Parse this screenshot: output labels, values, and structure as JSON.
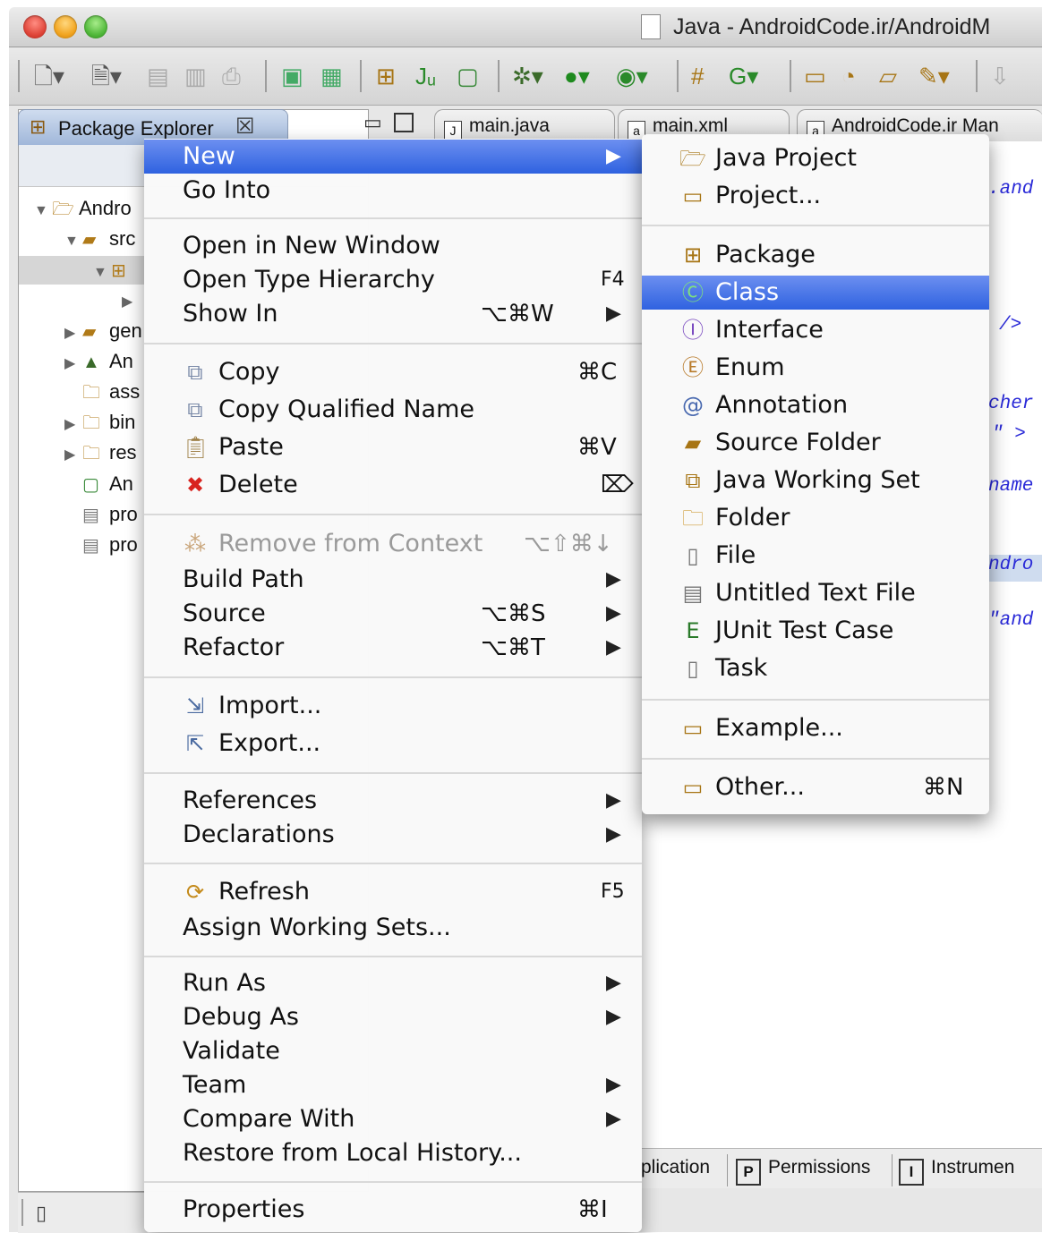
{
  "window": {
    "title": "Java - AndroidCode.ir/AndroidM"
  },
  "toolbar": {
    "icons": [
      "new-wizard-icon",
      "new-file-icon",
      "save-icon",
      "save-all-icon",
      "print-icon",
      "sdk-manager-icon",
      "avd-manager-icon",
      "new-java-project-icon",
      "new-junit-icon",
      "new-android-xml-icon",
      "debug-icon",
      "run-icon",
      "external-tools-icon",
      "new-package-icon",
      "new-class-icon",
      "open-type-icon",
      "open-task-icon",
      "search-icon",
      "flashlight-icon",
      "next-annotation-icon"
    ]
  },
  "package_explorer": {
    "tab_label": "Package Explorer",
    "close_glyph": "☒",
    "tree": [
      {
        "label": "Andro",
        "icon": "project-icon",
        "twisty": "▼"
      },
      {
        "label": "src",
        "icon": "source-folder-icon",
        "twisty": "▼"
      },
      {
        "label": "",
        "icon": "package-icon",
        "twisty": "▼"
      },
      {
        "label": "",
        "icon": "",
        "twisty": "▶"
      },
      {
        "label": "gen",
        "icon": "source-folder-icon",
        "twisty": "▶"
      },
      {
        "label": "An",
        "icon": "library-icon",
        "twisty": "▶"
      },
      {
        "label": "ass",
        "icon": "folder-icon",
        "twisty": ""
      },
      {
        "label": "bin",
        "icon": "folder-icon",
        "twisty": "▶"
      },
      {
        "label": "res",
        "icon": "folder-icon",
        "twisty": "▶"
      },
      {
        "label": "An",
        "icon": "xml-file-icon",
        "twisty": ""
      },
      {
        "label": "pro",
        "icon": "text-file-icon",
        "twisty": ""
      },
      {
        "label": "pro",
        "icon": "text-file-icon",
        "twisty": ""
      }
    ]
  },
  "editor": {
    "tabs": [
      {
        "label": "main.java",
        "icon": "J"
      },
      {
        "label": "main.xml",
        "icon": "a"
      },
      {
        "label": "AndroidCode.ir Man",
        "icon": "a"
      }
    ],
    "code_fragments": [
      ".and",
      "/>",
      "cher",
      "\" >",
      "name",
      "ndro",
      "\"and"
    ],
    "bottom_tabs": [
      {
        "label": "plication",
        "box": ""
      },
      {
        "label": "Permissions",
        "box": "P"
      },
      {
        "label": "Instrumen",
        "box": "I"
      }
    ]
  },
  "context_menu": {
    "items": [
      {
        "label": "New",
        "arrow": "▶",
        "highlighted": true
      },
      {
        "label": "Go Into"
      },
      {
        "label": "Open in New Window"
      },
      {
        "label": "Open Type Hierarchy",
        "shortcut": "F4"
      },
      {
        "label": "Show In",
        "shortcut": "⌥⌘W",
        "arrow": "▶"
      },
      {
        "label": "Copy",
        "shortcut": "⌘C",
        "icon": "copy-icon"
      },
      {
        "label": "Copy Qualified Name",
        "icon": "copy-qualified-name-icon"
      },
      {
        "label": "Paste",
        "shortcut": "⌘V",
        "icon": "paste-icon"
      },
      {
        "label": "Delete",
        "shortcut": "⌦",
        "icon": "delete-icon"
      },
      {
        "label": "Remove from Context",
        "shortcut": "⌥⇧⌘↓",
        "icon": "remove-context-icon",
        "disabled": true
      },
      {
        "label": "Build Path",
        "arrow": "▶"
      },
      {
        "label": "Source",
        "shortcut": "⌥⌘S",
        "arrow": "▶"
      },
      {
        "label": "Refactor",
        "shortcut": "⌥⌘T",
        "arrow": "▶"
      },
      {
        "label": "Import...",
        "icon": "import-icon"
      },
      {
        "label": "Export...",
        "icon": "export-icon"
      },
      {
        "label": "References",
        "arrow": "▶"
      },
      {
        "label": "Declarations",
        "arrow": "▶"
      },
      {
        "label": "Refresh",
        "shortcut": "F5",
        "icon": "refresh-icon"
      },
      {
        "label": "Assign Working Sets..."
      },
      {
        "label": "Run As",
        "arrow": "▶"
      },
      {
        "label": "Debug As",
        "arrow": "▶"
      },
      {
        "label": "Validate"
      },
      {
        "label": "Team",
        "arrow": "▶"
      },
      {
        "label": "Compare With",
        "arrow": "▶"
      },
      {
        "label": "Restore from Local History..."
      },
      {
        "label": "Properties",
        "shortcut": "⌘I"
      }
    ]
  },
  "new_submenu": {
    "items": [
      {
        "label": "Java Project",
        "icon": "java-project-icon"
      },
      {
        "label": "Project...",
        "icon": "project-wizard-icon"
      },
      {
        "label": "Package",
        "icon": "package-icon"
      },
      {
        "label": "Class",
        "icon": "class-icon",
        "highlighted": true
      },
      {
        "label": "Interface",
        "icon": "interface-icon"
      },
      {
        "label": "Enum",
        "icon": "enum-icon"
      },
      {
        "label": "Annotation",
        "icon": "annotation-icon"
      },
      {
        "label": "Source Folder",
        "icon": "source-folder-icon"
      },
      {
        "label": "Java Working Set",
        "icon": "working-set-icon"
      },
      {
        "label": "Folder",
        "icon": "folder-icon"
      },
      {
        "label": "File",
        "icon": "file-icon"
      },
      {
        "label": "Untitled Text File",
        "icon": "text-file-icon"
      },
      {
        "label": "JUnit Test Case",
        "icon": "junit-icon"
      },
      {
        "label": "Task",
        "icon": "task-icon"
      },
      {
        "label": "Example...",
        "icon": "example-icon"
      },
      {
        "label": "Other...",
        "shortcut": "⌘N",
        "icon": "other-wizard-icon"
      }
    ]
  },
  "colors": {
    "menu_highlight": "#2f62e0",
    "code_text": "#2a2ad8",
    "delete_red": "#d8231e"
  }
}
